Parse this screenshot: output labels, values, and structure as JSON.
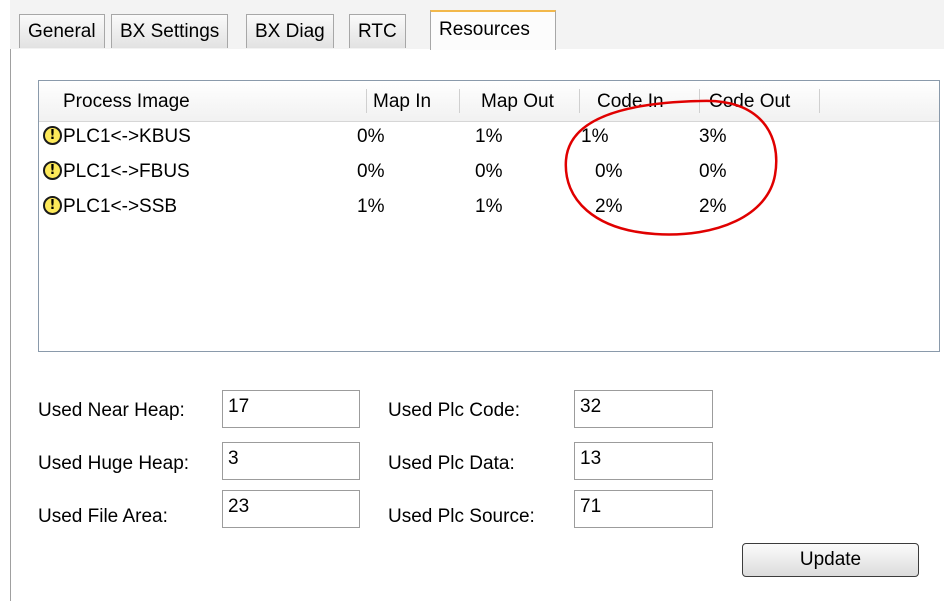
{
  "tabs": [
    {
      "label": "General",
      "active": false
    },
    {
      "label": "BX Settings",
      "active": false
    },
    {
      "label": "BX Diag",
      "active": false
    },
    {
      "label": "RTC",
      "active": false
    },
    {
      "label": "Resources",
      "active": true
    }
  ],
  "process_table": {
    "columns": [
      "Process Image",
      "Map In",
      "Map Out",
      "Code In",
      "Code Out"
    ],
    "rows": [
      {
        "icon": "warning-icon",
        "icon_glyph": "!",
        "name": "PLC1<->KBUS",
        "map_in": "0%",
        "map_out": "1%",
        "code_in": "1%",
        "code_out": "3%"
      },
      {
        "icon": "warning-icon",
        "icon_glyph": "!",
        "name": "PLC1<->FBUS",
        "map_in": "0%",
        "map_out": "0%",
        "code_in": "0%",
        "code_out": "0%"
      },
      {
        "icon": "warning-icon",
        "icon_glyph": "!",
        "name": "PLC1<->SSB",
        "map_in": "1%",
        "map_out": "1%",
        "code_in": "2%",
        "code_out": "2%"
      }
    ]
  },
  "stats": {
    "used_near_heap": {
      "label": "Used Near Heap:",
      "value": "17"
    },
    "used_huge_heap": {
      "label": "Used Huge Heap:",
      "value": "3"
    },
    "used_file_area": {
      "label": "Used File Area:",
      "value": "23"
    },
    "used_plc_code": {
      "label": "Used Plc Code:",
      "value": "32"
    },
    "used_plc_data": {
      "label": "Used Plc Data:",
      "value": "13"
    },
    "used_plc_source": {
      "label": "Used Plc Source:",
      "value": "71"
    }
  },
  "update_button": {
    "label": "Update"
  },
  "colors": {
    "tab_active_accent": "#f2b84b",
    "annotation_circle": "#e00000",
    "warning_fill": "#fde95a"
  }
}
